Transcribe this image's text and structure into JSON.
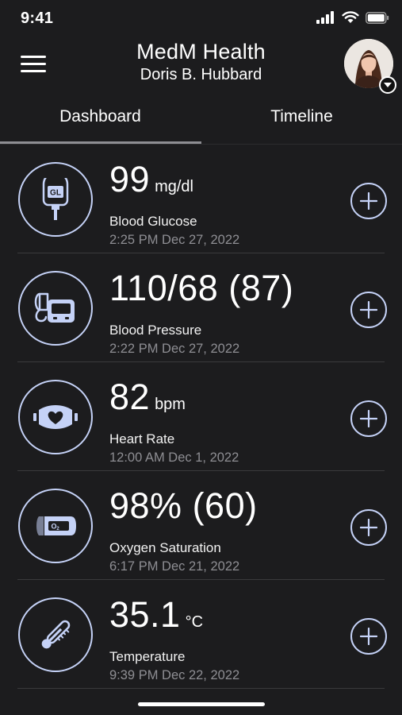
{
  "status_bar": {
    "time": "9:41"
  },
  "header": {
    "app_title": "MedM Health",
    "user_name": "Doris B. Hubbard"
  },
  "tabs": [
    {
      "label": "Dashboard",
      "active": true
    },
    {
      "label": "Timeline",
      "active": false
    }
  ],
  "colors": {
    "background": "#1c1c1e",
    "accent": "#c5d2f7",
    "muted_text": "#8e8e93",
    "divider": "#3a3a3c"
  },
  "measurements": [
    {
      "value": "99",
      "unit": "mg/dl",
      "label": "Blood Glucose",
      "timestamp": "2:25 PM Dec 27, 2022",
      "icon": "glucometer-icon"
    },
    {
      "value": "110/68 (87)",
      "unit": "",
      "label": "Blood Pressure",
      "timestamp": "2:22 PM Dec 27, 2022",
      "icon": "blood-pressure-monitor-icon"
    },
    {
      "value": "82",
      "unit": "bpm",
      "label": "Heart Rate",
      "timestamp": "12:00 AM Dec 1, 2022",
      "icon": "heart-rate-strap-icon"
    },
    {
      "value": "98% (60)",
      "unit": "",
      "label": "Oxygen Saturation",
      "timestamp": "6:17 PM Dec 21, 2022",
      "icon": "pulse-oximeter-icon"
    },
    {
      "value": "35.1",
      "unit": "°C",
      "label": "Temperature",
      "timestamp": "9:39 PM Dec 22, 2022",
      "icon": "thermometer-icon"
    }
  ]
}
